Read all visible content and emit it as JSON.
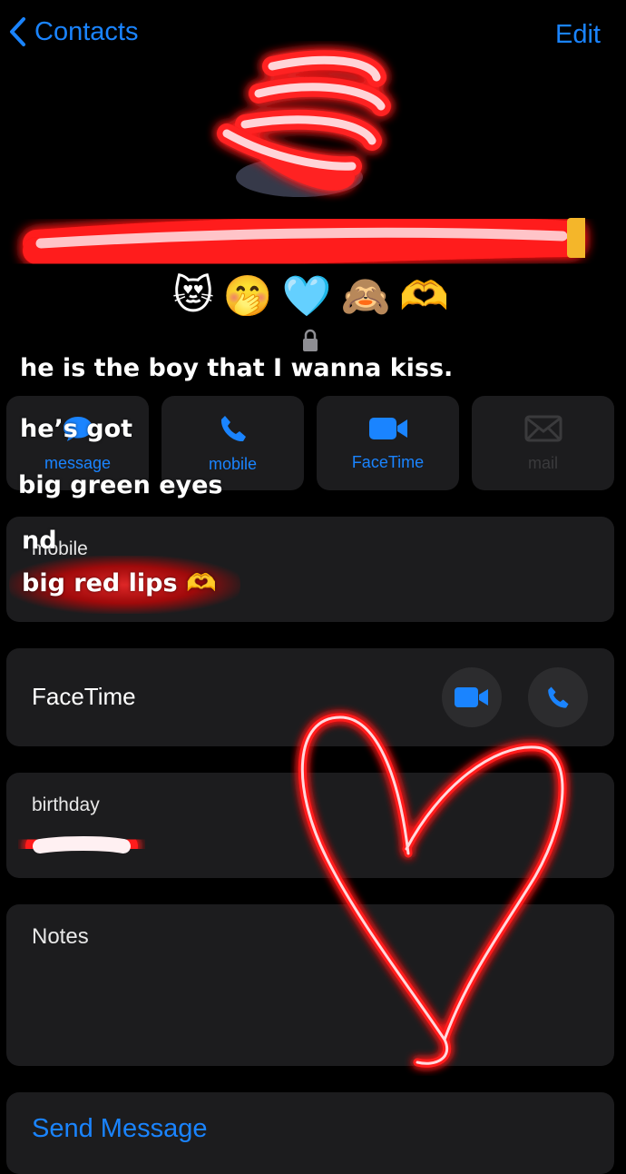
{
  "nav": {
    "back_label": "Contacts",
    "edit_label": "Edit"
  },
  "emoji_row": [
    "😻",
    "🤭",
    "🩵",
    "🙈",
    "🫶"
  ],
  "actions": [
    {
      "label": "message",
      "icon": "message-bubble-icon"
    },
    {
      "label": "mobile",
      "icon": "phone-icon"
    },
    {
      "label": "FaceTime",
      "icon": "video-camera-icon"
    },
    {
      "label": "mail",
      "icon": "envelope-icon"
    }
  ],
  "mobile_card": {
    "label": "mobile"
  },
  "facetime_card": {
    "label": "FaceTime"
  },
  "birthday_card": {
    "label": "birthday"
  },
  "notes_card": {
    "label": "Notes"
  },
  "send_message": {
    "label": "Send Message"
  },
  "overlay_text": {
    "line1": "he is the boy that I wanna kiss.",
    "line2": "he’s got",
    "line3": "big green eyes",
    "line4": "nd",
    "line5": "big red lips 🫶"
  },
  "colors": {
    "accent": "#1a84ff",
    "card": "#1c1c1e",
    "neon": "#ff2a2a",
    "background": "#000000"
  }
}
